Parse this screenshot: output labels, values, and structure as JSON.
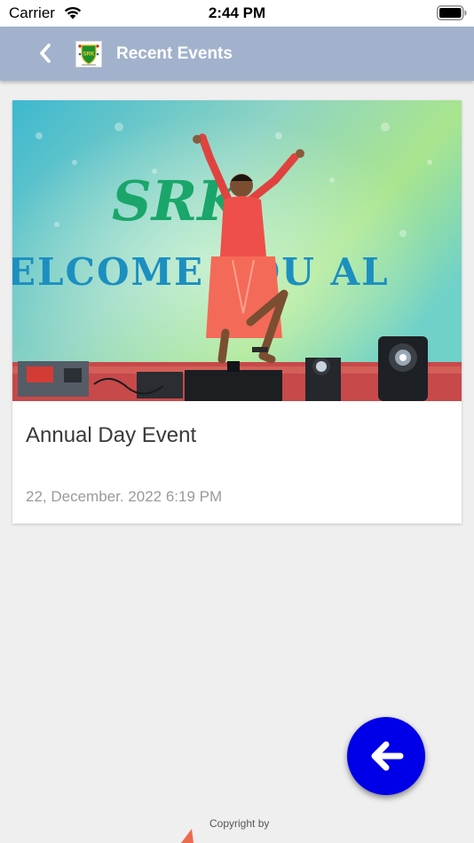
{
  "status_bar": {
    "carrier": "Carrier",
    "time": "2:44 PM"
  },
  "header": {
    "title": "Recent Events",
    "back_icon": "chevron-left-icon",
    "logo_text": "SRK",
    "background": "#a2b2cc"
  },
  "events": [
    {
      "title": "Annual Day Event",
      "date": "22, December. 2022 6:19 PM",
      "banner_text_line1": "SRK",
      "banner_text_line2": "ELCOME YOU AL"
    }
  ],
  "fab": {
    "icon": "arrow-left-icon",
    "color": "#0000e8"
  },
  "footer": {
    "copyright_label": "Copyright by"
  }
}
